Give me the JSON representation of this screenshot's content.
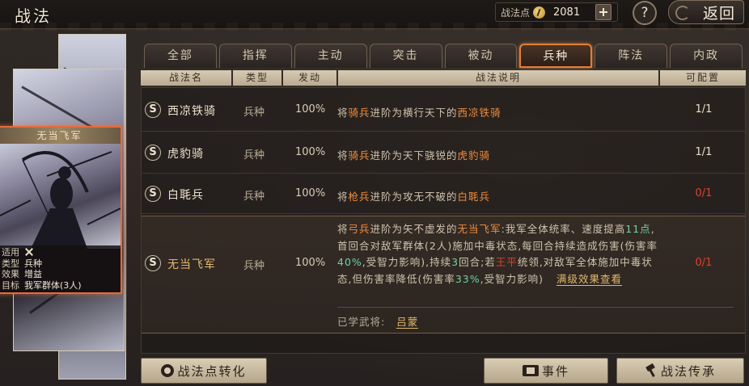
{
  "header": {
    "title": "战法",
    "points_label": "战法点",
    "points_value": "2081",
    "help_label": "?",
    "back_label": "返回"
  },
  "tabs": [
    {
      "label": "全部",
      "active": false
    },
    {
      "label": "指挥",
      "active": false
    },
    {
      "label": "主动",
      "active": false
    },
    {
      "label": "突击",
      "active": false
    },
    {
      "label": "被动",
      "active": false
    },
    {
      "label": "兵种",
      "active": true
    },
    {
      "label": "阵法",
      "active": false
    },
    {
      "label": "内政",
      "active": false
    }
  ],
  "table_headers": {
    "name": "战法名",
    "type": "类型",
    "trigger": "发动",
    "description": "战法说明",
    "configurable": "可配置"
  },
  "rows": [
    {
      "grade": "S",
      "name": "西凉铁骑",
      "type": "兵种",
      "rate": "100%",
      "desc_a": "将",
      "desc_b": "骑兵",
      "desc_c": "进阶为横行天下的",
      "desc_d": "西凉铁骑",
      "configurable": "1/1"
    },
    {
      "grade": "S",
      "name": "虎豹骑",
      "type": "兵种",
      "rate": "100%",
      "desc_a": "将",
      "desc_b": "骑兵",
      "desc_c": "进阶为天下骁锐的",
      "desc_d": "虎豹骑",
      "configurable": "1/1"
    },
    {
      "grade": "S",
      "name": "白毦兵",
      "type": "兵种",
      "rate": "100%",
      "desc_a": "将",
      "desc_b": "枪兵",
      "desc_c": "进阶为攻无不破的",
      "desc_d": "白毦兵",
      "configurable": "0/1"
    }
  ],
  "selected_row": {
    "grade": "S",
    "name": "无当飞军",
    "type": "兵种",
    "rate": "100%",
    "configurable": "0/1",
    "d1": "将",
    "d2": "弓兵",
    "d3": "进阶为矢不虚发的",
    "d4": "无当飞军",
    "d5": ":我军全体统率、速度提高",
    "d6": "11点",
    "d7": ",首回合对敌军群体(2人)施加中毒状态,每回合持续造成伤害(伤害率",
    "d8": "40%",
    "d9": ",受智力影响),持续",
    "d10": "3",
    "d11": "回合;若",
    "d12": "王平",
    "d13": "统领,对敌军全体施加中毒状态,但伤害率降低(伤害率",
    "d14": "33%",
    "d15": ",受智力影响)",
    "view_full": "满级效果查看",
    "learned_label": "已学武将:",
    "learned_name": "吕蒙"
  },
  "card": {
    "title": "无当飞军",
    "rows": [
      {
        "key": "适用",
        "value": ""
      },
      {
        "key": "类型",
        "value": "兵种"
      },
      {
        "key": "效果",
        "value": "增益"
      },
      {
        "key": "目标",
        "value": "我军群体(3人)"
      }
    ]
  },
  "buttons": {
    "convert": "战法点转化",
    "event": "事件",
    "inherit": "战法传承"
  },
  "colors": {
    "accent_orange": "#e57e3a",
    "highlight_orange": "#f08c3a",
    "warning_red": "#e0412c",
    "highlight_green": "#6ed3a2",
    "gold": "#e3b96d"
  }
}
